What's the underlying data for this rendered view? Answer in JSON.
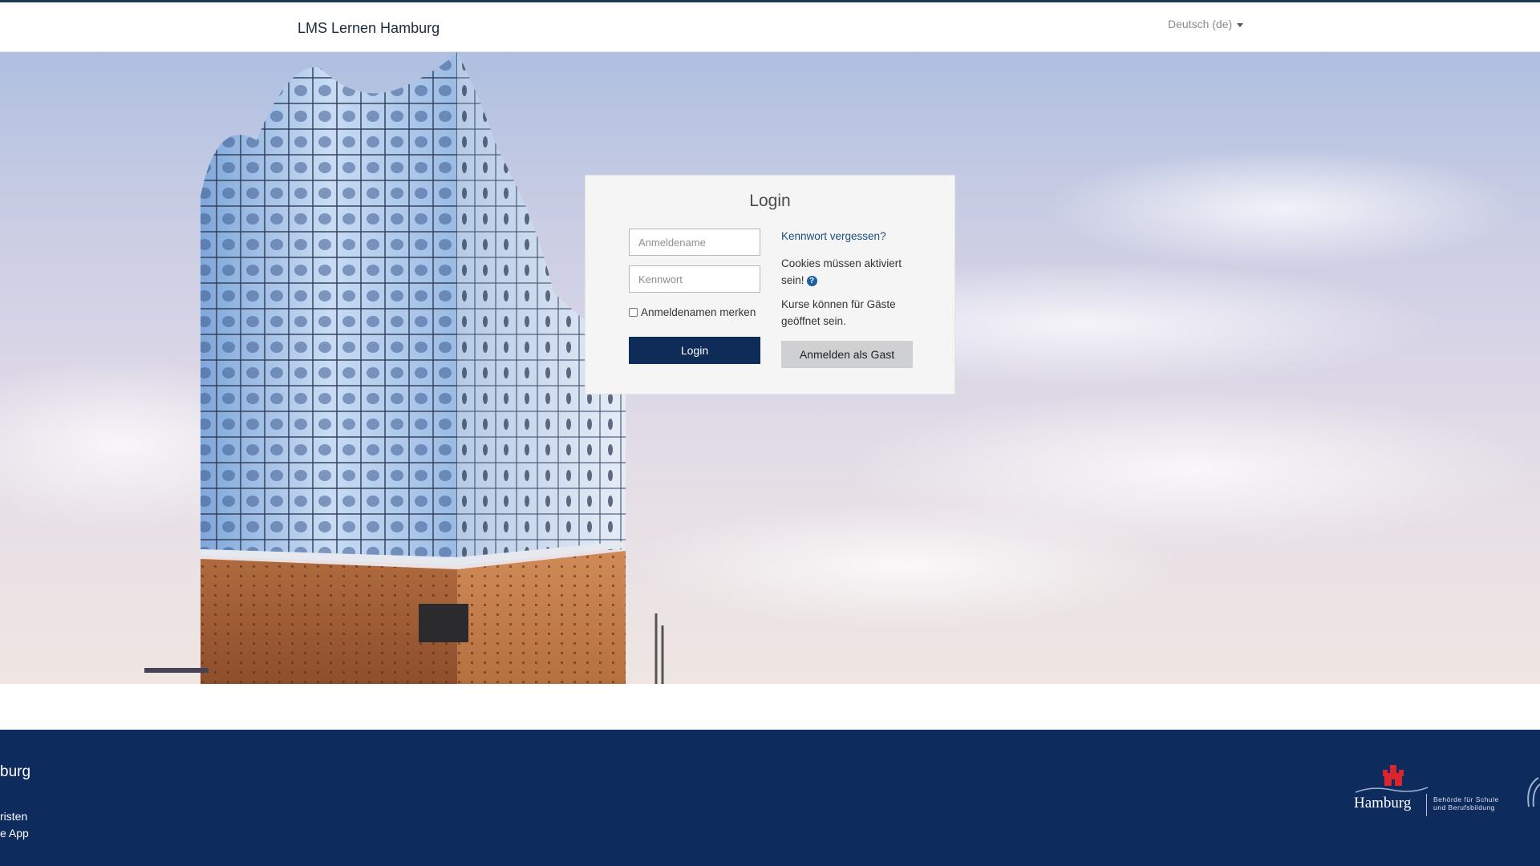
{
  "navbar": {
    "brand": "LMS Lernen Hamburg",
    "language": "Deutsch (de)"
  },
  "login": {
    "title": "Login",
    "username_placeholder": "Anmeldename",
    "password_placeholder": "Kennwort",
    "remember_label": "Anmeldenamen merken",
    "remember_checked": false,
    "login_button": "Login",
    "forgot_link": "Kennwort vergessen?",
    "cookies_line1": "Cookies müssen aktiviert",
    "cookies_line2": "sein!",
    "guest_line1": "Kurse können für Gäste",
    "guest_line2": "geöffnet sein.",
    "guest_button": "Anmelden als Gast"
  },
  "footer": {
    "title_fragment": "burg",
    "link1": "risten",
    "link2": "e App",
    "logo_word": "Hamburg",
    "logo_sub_line1": "Behörde für Schule",
    "logo_sub_line2": "und Berufsbildung"
  },
  "colors": {
    "navy": "#0d2b5c",
    "login_button": "#0f2b58",
    "link": "#1d4d7e"
  },
  "icons": {
    "help": "question-circle-icon",
    "language_caret": "caret-down-icon",
    "hamburg_crest": "castle-crest-icon"
  }
}
